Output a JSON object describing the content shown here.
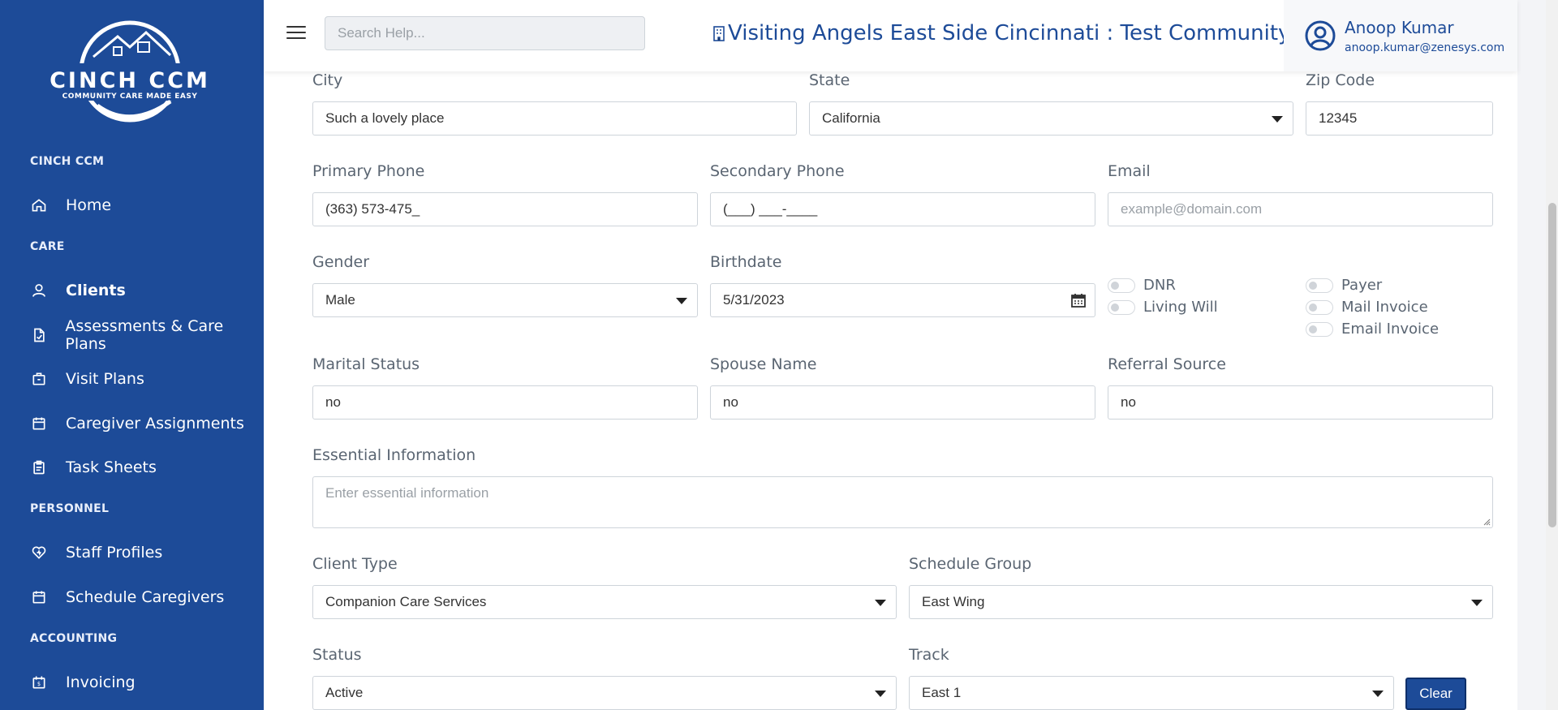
{
  "brand": {
    "logo_text": "CINCH CCM",
    "logo_tagline": "COMMUNITY CARE MADE EASY"
  },
  "sidebar": {
    "sections": [
      "CINCH CCM",
      "CARE",
      "PERSONNEL",
      "ACCOUNTING"
    ],
    "items": [
      {
        "label": "Home",
        "icon": "home-icon"
      },
      {
        "label": "Clients",
        "icon": "user-icon"
      },
      {
        "label": "Assessments & Care Plans",
        "icon": "document-icon"
      },
      {
        "label": "Visit Plans",
        "icon": "briefcase-icon"
      },
      {
        "label": "Caregiver Assignments",
        "icon": "calendar-icon"
      },
      {
        "label": "Task Sheets",
        "icon": "clipboard-icon"
      },
      {
        "label": "Staff Profiles",
        "icon": "heart-icon"
      },
      {
        "label": "Schedule Caregivers",
        "icon": "calendar-icon"
      },
      {
        "label": "Invoicing",
        "icon": "invoice-icon"
      }
    ],
    "active": "Clients"
  },
  "header": {
    "search_placeholder": "Search Help...",
    "community": "Visiting Angels East Side Cincinnati : Test Community",
    "user_name": "Anoop Kumar",
    "user_email": "anoop.kumar@zenesys.com"
  },
  "form": {
    "city": {
      "label": "City",
      "value": "Such a lovely place"
    },
    "state": {
      "label": "State",
      "value": "California"
    },
    "zip": {
      "label": "Zip Code",
      "value": "12345"
    },
    "primary_phone": {
      "label": "Primary Phone",
      "value": "(363) 573-475_"
    },
    "secondary_phone": {
      "label": "Secondary Phone",
      "value": "(___) ___-____"
    },
    "email": {
      "label": "Email",
      "placeholder": "example@domain.com"
    },
    "gender": {
      "label": "Gender",
      "value": "Male"
    },
    "birthdate": {
      "label": "Birthdate",
      "value": "5/31/2023"
    },
    "toggles_left": [
      "DNR",
      "Living Will"
    ],
    "toggles_right": [
      "Payer",
      "Mail Invoice",
      "Email Invoice"
    ],
    "marital_status": {
      "label": "Marital Status",
      "value": "no"
    },
    "spouse_name": {
      "label": "Spouse Name",
      "value": "no"
    },
    "referral_source": {
      "label": "Referral Source",
      "value": "no"
    },
    "essential_info": {
      "label": "Essential Information",
      "placeholder": "Enter essential information"
    },
    "client_type": {
      "label": "Client Type",
      "value": "Companion Care Services"
    },
    "schedule_group": {
      "label": "Schedule Group",
      "value": "East Wing"
    },
    "status": {
      "label": "Status",
      "value": "Active"
    },
    "track": {
      "label": "Track",
      "value": "East 1"
    },
    "clear_label": "Clear"
  },
  "colors": {
    "primary": "#1d4b98",
    "border": "#ced4da"
  }
}
